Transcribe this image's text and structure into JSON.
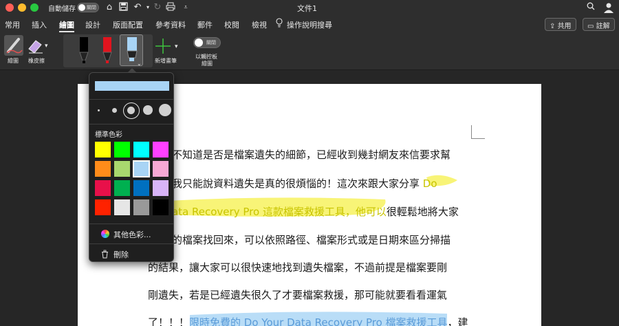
{
  "titlebar": {
    "autosave_label": "自動儲存",
    "autosave_toggle": "關閉",
    "doc_title": "文件1"
  },
  "menu": {
    "tabs": [
      {
        "label": "常用",
        "active": false
      },
      {
        "label": "插入",
        "active": false
      },
      {
        "label": "繪圖",
        "active": true
      },
      {
        "label": "設計",
        "active": false
      },
      {
        "label": "版面配置",
        "active": false
      },
      {
        "label": "參考資料",
        "active": false
      },
      {
        "label": "郵件",
        "active": false
      },
      {
        "label": "校閱",
        "active": false
      },
      {
        "label": "檢視",
        "active": false
      }
    ],
    "tell_me": "操作說明搜尋",
    "share": "共用",
    "comment": "註解"
  },
  "ribbon": {
    "draw_label": "繪圖",
    "eraser_label": "橡皮擦",
    "add_pen_label": "新增畫筆",
    "touchpad_toggle": "關閉",
    "touchpad_label_line1": "以觸控板",
    "touchpad_label_line2": "繪圖"
  },
  "popup": {
    "standard_colors_label": "標準色彩",
    "more_colors_label": "其他色彩...",
    "delete_label": "刪除",
    "swatches": [
      "#ffff00",
      "#00ff00",
      "#00ffff",
      "#ff40ff",
      "#ff8c1a",
      "#a9d86e",
      "#a8d4f5",
      "#f7a8d4",
      "#e8104a",
      "#00b050",
      "#0070c0",
      "#d8b4f8",
      "#ff2200",
      "#e6e6e6",
      "#999999",
      "#000000"
    ],
    "selected_swatch": "#a8d4f5",
    "selected_size_index": 2
  },
  "document": {
    "lines": [
      {
        "text": "不知道是否是檔案遺失的細節，已經收到幾封網友來信要求幫"
      },
      {
        "text": "我只能說資料遺失是真的很煩惱的！這次來跟大家分享 ",
        "hl": "Do"
      },
      {
        "hl": "ata Recovery Pro  這款檔案救援工具，他可以",
        "text": "很輕鬆地將大家"
      },
      {
        "text": "的檔案找回來，可以依照路徑、檔案形式或是日期來區分掃描"
      },
      {
        "text": "的結果，讓大家可以很快速地找到遺失檔案，不過前提是檔案要剛"
      },
      {
        "text": "剛遺失，若是已經遺失很久了才要檔案救援，那可能就要看看運氣"
      },
      {
        "text": "了！！！",
        "hl2": "限時免費的  Do Your Data Recovery Pro  檔案救援工具",
        "text2": "，建"
      }
    ]
  },
  "colors": {
    "chrome": "#2e2e2e",
    "canvas": "#262626",
    "highlight_yellow": "#f5f04a",
    "highlight_blue": "#a8d4f5"
  }
}
